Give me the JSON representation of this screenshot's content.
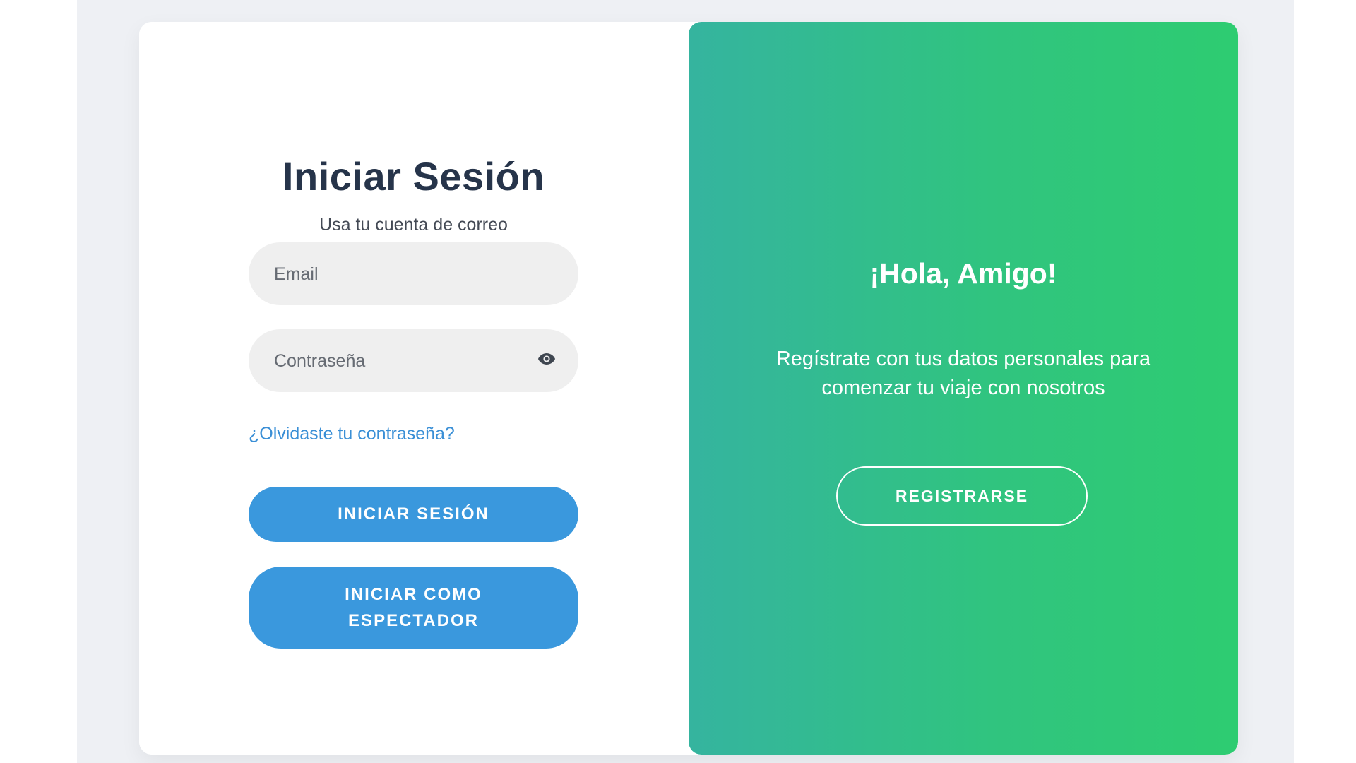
{
  "login": {
    "title": "Iniciar Sesión",
    "subtitle": "Usa tu cuenta de correo",
    "email_placeholder": "Email",
    "password_placeholder": "Contraseña",
    "forgot_link": "¿Olvidaste tu contraseña?",
    "login_button": "INICIAR SESIÓN",
    "spectator_button_line1": "INICIAR COMO",
    "spectator_button_line2": "ESPECTADOR"
  },
  "register_panel": {
    "heading": "¡Hola, Amigo!",
    "message": "Regístrate con tus datos personales para comenzar tu viaje con nosotros",
    "register_button": "REGISTRARSE"
  },
  "icons": {
    "password_toggle": "eye-icon"
  },
  "colors": {
    "primary_button": "#3a98dd",
    "link": "#3a8fd6",
    "title_text": "#26344a",
    "gradient_start": "#35b49f",
    "gradient_end": "#2ecc71",
    "input_background": "#efefef",
    "page_background": "#eef0f4"
  }
}
